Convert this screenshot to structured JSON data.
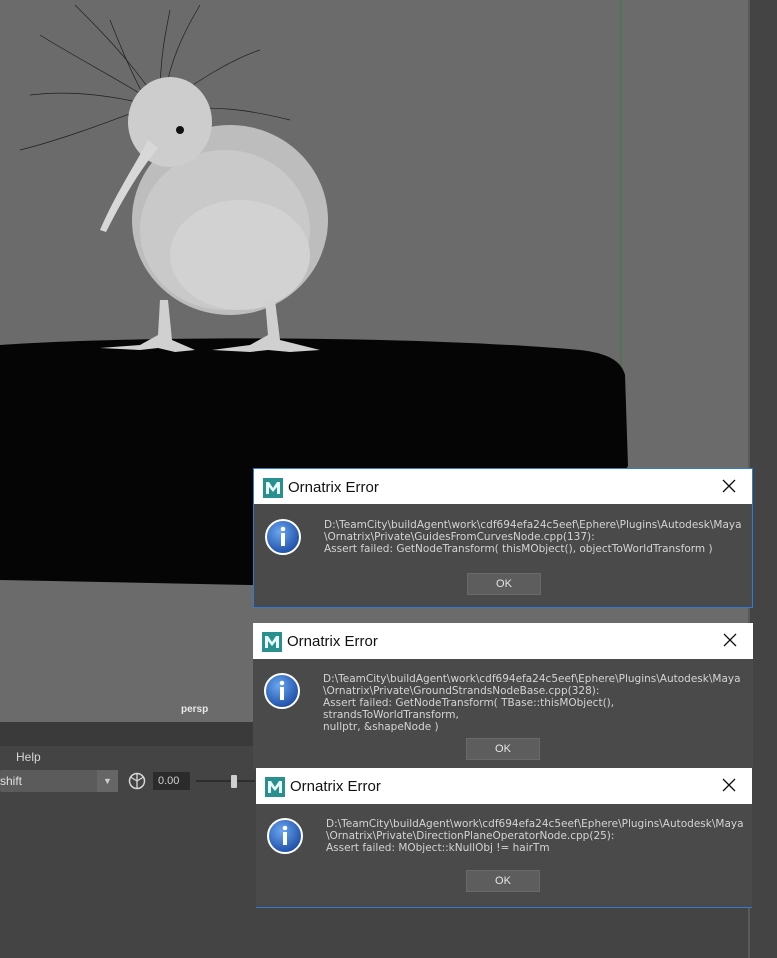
{
  "viewport": {
    "camera_label": "persp"
  },
  "maya_ui": {
    "menu_help": "Help",
    "dropdown_value": "shift",
    "dropdown_arrow": "▼",
    "numeric_value": "0.00"
  },
  "dialogs": [
    {
      "title": "Ornatrix Error",
      "message": "D:\\TeamCity\\buildAgent\\work\\cdf694efa24c5eef\\Ephere\\Plugins\\Autodesk\\Maya\n\\Ornatrix\\Private\\GuidesFromCurvesNode.cpp(137):\nAssert failed: GetNodeTransform( thisMObject(), objectToWorldTransform )",
      "ok_label": "OK"
    },
    {
      "title": "Ornatrix Error",
      "message": "D:\\TeamCity\\buildAgent\\work\\cdf694efa24c5eef\\Ephere\\Plugins\\Autodesk\\Maya\n\\Ornatrix\\Private\\GroundStrandsNodeBase.cpp(328):\nAssert failed: GetNodeTransform( TBase::thisMObject(), strandsToWorldTransform,\nnullptr, &shapeNode )",
      "ok_label": "OK"
    },
    {
      "title": "Ornatrix Error",
      "message": "D:\\TeamCity\\buildAgent\\work\\cdf694efa24c5eef\\Ephere\\Plugins\\Autodesk\\Maya\n\\Ornatrix\\Private\\DirectionPlaneOperatorNode.cpp(25):\nAssert failed: MObject::kNullObj != hairTm",
      "ok_label": "OK"
    }
  ],
  "colors": {
    "viewport_bg": "#6b6b6b",
    "dialog_bg": "#4a4a4a",
    "accent_border": "#2f7ad6",
    "maya_logo": "#2fa8a8"
  },
  "icons": [
    "maya-logo-icon",
    "close-icon",
    "info-icon",
    "camera-gizmo-icon",
    "chevron-down-icon"
  ]
}
